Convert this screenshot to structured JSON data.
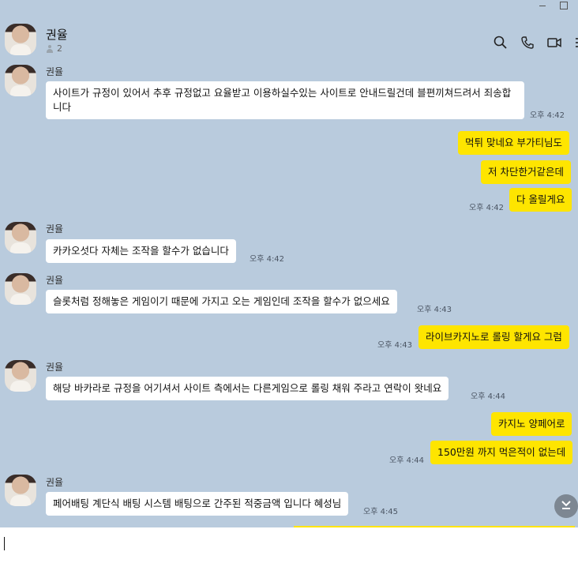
{
  "window_controls": {
    "minimize": "minimize-icon",
    "maximize": "maximize-icon"
  },
  "header": {
    "title": "권율",
    "member_count": "2",
    "icons": [
      "search-icon",
      "phone-icon",
      "video-call-icon",
      "menu-icon"
    ]
  },
  "messages": [
    {
      "side": "in",
      "sender": "권율",
      "text": "사이트가 규정이 있어서 추후 규정없고 요율받고 이용하실수있는 사이트로 안내드릴건데 블편끼쳐드려서 죄송합니다",
      "time": "오후 4:42"
    },
    {
      "side": "out",
      "text": "먹튀 맞네요 부가티님도"
    },
    {
      "side": "out",
      "text": "저 차단한거같은데"
    },
    {
      "side": "out",
      "text": "다 올릴게요",
      "time": "오후 4:42"
    },
    {
      "side": "in",
      "sender": "권율",
      "text": "카카오섯다 자체는 조작을 할수가 없습니다",
      "time": "오후 4:42"
    },
    {
      "side": "in",
      "sender": "권율",
      "text": "슬롯처럼 정해놓은 게임이기 때문에 가지고 오는 게임인데 조작을 할수가 없으세요",
      "time": "오후 4:43"
    },
    {
      "side": "out",
      "text": "라이브카지노로 롤링 할게요 그럼",
      "time": "오후 4:43"
    },
    {
      "side": "in",
      "sender": "권율",
      "text": "해당 바카라로 규정을 어기셔서 사이트 측에서는 다른게임으로 롤링 채워 주라고 연락이 왓네요",
      "time": "오후 4:44"
    },
    {
      "side": "out",
      "text": "카지노 양페어로"
    },
    {
      "side": "out",
      "text": "150만원 까지 먹은적이 없는데",
      "time": "오후 4:44"
    },
    {
      "side": "in",
      "sender": "권율",
      "text": "페어배팅 계단식 배팅 시스템 배팅으로 간주된 적중금액 입니다 혜성님",
      "time": "오후 4:45"
    }
  ],
  "controls": {
    "scroll_down_icon": "chevron-down-icon"
  },
  "input": {
    "value": ""
  },
  "colors": {
    "background": "#b9cbdd",
    "outgoing_bubble": "#fee500",
    "incoming_bubble": "#ffffff"
  }
}
